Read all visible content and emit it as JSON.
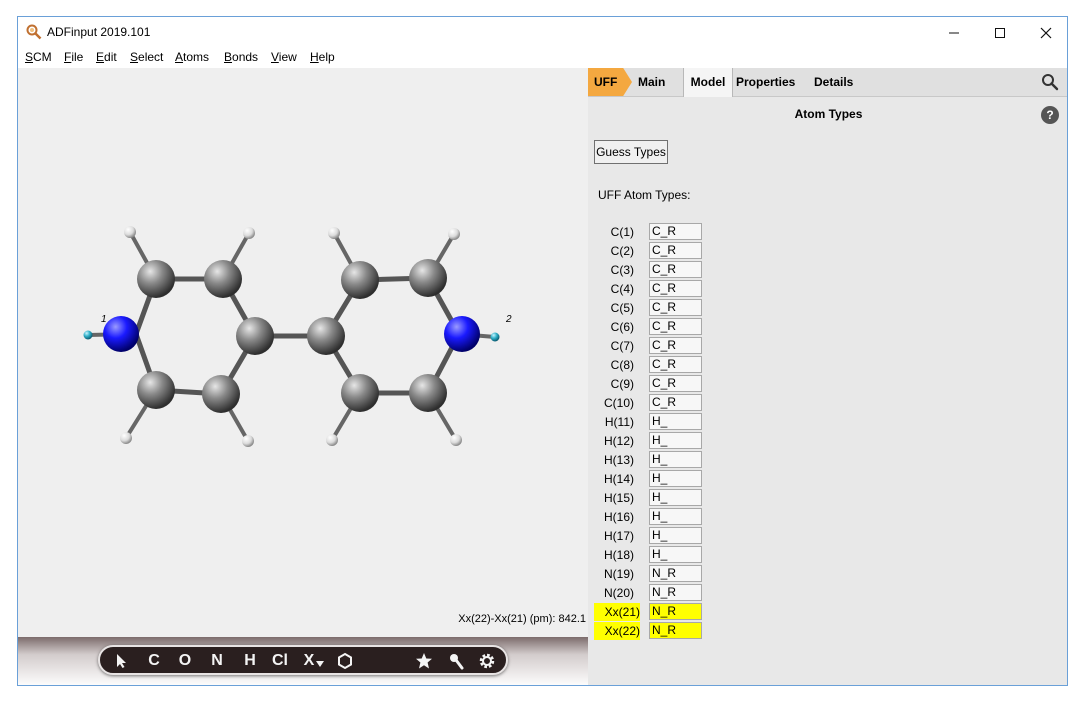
{
  "window": {
    "title": "ADFinput 2019.101"
  },
  "menu": [
    {
      "pre": "",
      "ul": "S",
      "post": "CM"
    },
    {
      "pre": "",
      "ul": "F",
      "post": "ile"
    },
    {
      "pre": "",
      "ul": "E",
      "post": "dit"
    },
    {
      "pre": "",
      "ul": "S",
      "post": "elect"
    },
    {
      "pre": "",
      "ul": "A",
      "post": "toms"
    },
    {
      "pre": "",
      "ul": "B",
      "post": "onds"
    },
    {
      "pre": "",
      "ul": "V",
      "post": "iew"
    },
    {
      "pre": "",
      "ul": "H",
      "post": "elp"
    }
  ],
  "viewport": {
    "status": "Xx(22)-Xx(21) (pm): 842.1",
    "dummy_labels": [
      "1",
      "2"
    ]
  },
  "toolbar": {
    "tools": [
      "C",
      "O",
      "N",
      "H",
      "Cl",
      "X"
    ],
    "icons": [
      "pointer-icon",
      "ring-icon",
      "star-icon",
      "wrench-icon",
      "gear-icon"
    ]
  },
  "panel": {
    "tabs": [
      "UFF",
      "Main",
      "Model",
      "Properties",
      "Details"
    ],
    "active_tab": "Model",
    "section_title": "Atom Types",
    "help_label": "?",
    "guess_button": "Guess Types",
    "types_label": "UFF Atom Types:",
    "rows": [
      {
        "label": "C(1)",
        "value": "C_R",
        "hl": false
      },
      {
        "label": "C(2)",
        "value": "C_R",
        "hl": false
      },
      {
        "label": "C(3)",
        "value": "C_R",
        "hl": false
      },
      {
        "label": "C(4)",
        "value": "C_R",
        "hl": false
      },
      {
        "label": "C(5)",
        "value": "C_R",
        "hl": false
      },
      {
        "label": "C(6)",
        "value": "C_R",
        "hl": false
      },
      {
        "label": "C(7)",
        "value": "C_R",
        "hl": false
      },
      {
        "label": "C(8)",
        "value": "C_R",
        "hl": false
      },
      {
        "label": "C(9)",
        "value": "C_R",
        "hl": false
      },
      {
        "label": "C(10)",
        "value": "C_R",
        "hl": false
      },
      {
        "label": "H(11)",
        "value": "H_",
        "hl": false
      },
      {
        "label": "H(12)",
        "value": "H_",
        "hl": false
      },
      {
        "label": "H(13)",
        "value": "H_",
        "hl": false
      },
      {
        "label": "H(14)",
        "value": "H_",
        "hl": false
      },
      {
        "label": "H(15)",
        "value": "H_",
        "hl": false
      },
      {
        "label": "H(16)",
        "value": "H_",
        "hl": false
      },
      {
        "label": "H(17)",
        "value": "H_",
        "hl": false
      },
      {
        "label": "H(18)",
        "value": "H_",
        "hl": false
      },
      {
        "label": "N(19)",
        "value": "N_R",
        "hl": false
      },
      {
        "label": "N(20)",
        "value": "N_R",
        "hl": false
      },
      {
        "label": "Xx(21)",
        "value": "N_R",
        "hl": true
      },
      {
        "label": "Xx(22)",
        "value": "N_R",
        "hl": true
      }
    ]
  },
  "colors": {
    "accent_tab": "#f4a840",
    "highlight": "#ffff00",
    "nitrogen": "#1a1aff",
    "carbon": "#7a7a7a",
    "dummy": "#30b0c8"
  }
}
